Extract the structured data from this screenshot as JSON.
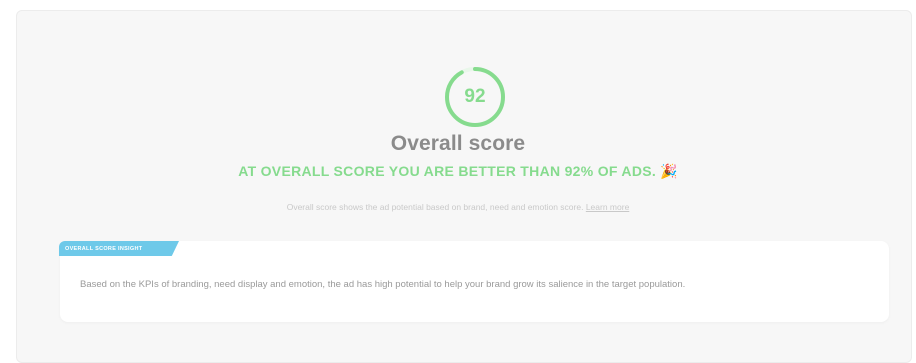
{
  "score": {
    "value": "92",
    "percent": 92,
    "ring_color": "#86db8e",
    "ring_track_color": "#e9f7ea"
  },
  "title": "Overall score",
  "headline": "AT OVERALL SCORE YOU ARE BETTER THAN 92% OF ADS.",
  "headline_icon": "party-popper-icon",
  "description": {
    "text": "Overall score shows the ad potential based on brand, need and emotion score.",
    "link_label": "Learn more"
  },
  "insight": {
    "badge_label": "OVERALL SCORE INSIGHT",
    "badge_color": "#6ec9e9",
    "text": "Based on the KPIs of branding, need display and emotion, the ad has high potential to help your brand grow its salience in the target population."
  }
}
